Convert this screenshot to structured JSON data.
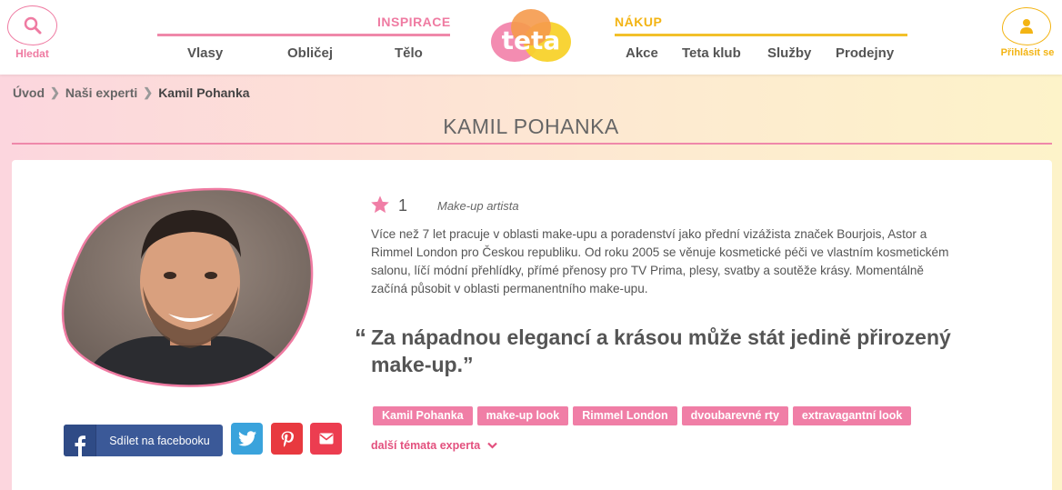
{
  "header": {
    "search_label": "Hledat",
    "login_label": "Přihlásit se",
    "logo_text": "teta",
    "inspirace": {
      "title": "INSPIRACE",
      "items": [
        {
          "label": "Vlasy"
        },
        {
          "label": "Obličej"
        },
        {
          "label": "Tělo"
        }
      ]
    },
    "nakup": {
      "title": "NÁKUP",
      "items": [
        {
          "label": "Akce"
        },
        {
          "label": "Teta klub"
        },
        {
          "label": "Služby"
        },
        {
          "label": "Prodejny"
        }
      ]
    }
  },
  "breadcrumb": {
    "items": [
      {
        "label": "Úvod"
      },
      {
        "label": "Naši experti"
      },
      {
        "label": "Kamil Pohanka"
      }
    ]
  },
  "page_title": "KAMIL POHANKA",
  "expert": {
    "rating": "1",
    "role": "Make-up artista",
    "bio": "Více než 7 let pracuje v oblasti make-upu a poradenství jako přední vizážista značek Bourjois, Astor a Rimmel London pro Českou republiku. Od roku 2005 se věnuje kosmetické péči ve vlastním kosmetickém salonu, líčí módní přehlídky, přímé přenosy pro TV Prima, plesy, svatby a soutěže krásy. Momentálně začíná působit v oblasti permanentního make-upu.",
    "quote_open": "“",
    "quote": "Za nápadnou elegancí a krásou může stát jedině přirozený make-up.”",
    "tags": [
      {
        "label": "Kamil Pohanka"
      },
      {
        "label": "make-up look"
      },
      {
        "label": "Rimmel London"
      },
      {
        "label": "dvoubarevné rty"
      },
      {
        "label": "extravagantní look"
      }
    ],
    "more_topics": "další témata experta"
  },
  "share": {
    "facebook_label": "Sdílet na facebooku"
  },
  "colors": {
    "pink": "#ef7ba2",
    "yellow": "#f3b414",
    "facebook": "#3b5998",
    "twitter": "#3aa3dc",
    "pinterest": "#e8393f",
    "mail": "#ec3d50"
  }
}
